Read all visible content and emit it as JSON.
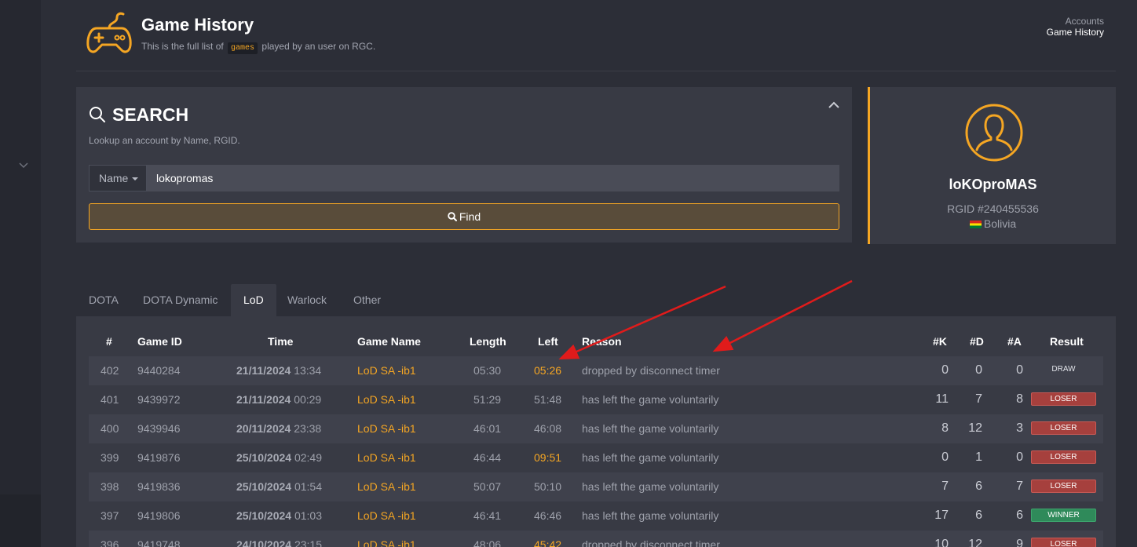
{
  "header": {
    "title": "Game History",
    "subtitle_before": "This is the full list of",
    "subtitle_code": "games",
    "subtitle_after": "played by an user on RGC.",
    "breadcrumb": [
      "Accounts",
      "Game History"
    ]
  },
  "search": {
    "title": "SEARCH",
    "help": "Lookup an account by Name, RGID.",
    "field_type": "Name",
    "value": "lokopromas",
    "button_label": "Find"
  },
  "profile": {
    "name": "loKOproMAS",
    "rgid": "RGID #240455536",
    "country": "Bolivia"
  },
  "tabs": [
    "DOTA",
    "DOTA Dynamic",
    "LoD",
    "Warlock",
    "Other"
  ],
  "active_tab": "LoD",
  "table": {
    "headers": {
      "num": "#",
      "game_id": "Game ID",
      "time": "Time",
      "game_name": "Game Name",
      "length": "Length",
      "left": "Left",
      "reason": "Reason",
      "k": "#K",
      "d": "#D",
      "a": "#A",
      "result": "Result"
    },
    "rows": [
      {
        "num": "402",
        "game_id": "9440284",
        "date": "21/11/2024",
        "clock": "13:34",
        "game_name": "LoD SA -ib1",
        "length": "05:30",
        "left": "05:26",
        "left_highlight": true,
        "reason": "dropped by disconnect timer",
        "k": "0",
        "d": "0",
        "a": "0",
        "result": "DRAW"
      },
      {
        "num": "401",
        "game_id": "9439972",
        "date": "21/11/2024",
        "clock": "00:29",
        "game_name": "LoD SA -ib1",
        "length": "51:29",
        "left": "51:48",
        "left_highlight": false,
        "reason": "has left the game voluntarily",
        "k": "11",
        "d": "7",
        "a": "8",
        "result": "LOSER"
      },
      {
        "num": "400",
        "game_id": "9439946",
        "date": "20/11/2024",
        "clock": "23:38",
        "game_name": "LoD SA -ib1",
        "length": "46:01",
        "left": "46:08",
        "left_highlight": false,
        "reason": "has left the game voluntarily",
        "k": "8",
        "d": "12",
        "a": "3",
        "result": "LOSER"
      },
      {
        "num": "399",
        "game_id": "9419876",
        "date": "25/10/2024",
        "clock": "02:49",
        "game_name": "LoD SA -ib1",
        "length": "46:44",
        "left": "09:51",
        "left_highlight": true,
        "reason": "has left the game voluntarily",
        "k": "0",
        "d": "1",
        "a": "0",
        "result": "LOSER"
      },
      {
        "num": "398",
        "game_id": "9419836",
        "date": "25/10/2024",
        "clock": "01:54",
        "game_name": "LoD SA -ib1",
        "length": "50:07",
        "left": "50:10",
        "left_highlight": false,
        "reason": "has left the game voluntarily",
        "k": "7",
        "d": "6",
        "a": "7",
        "result": "LOSER"
      },
      {
        "num": "397",
        "game_id": "9419806",
        "date": "25/10/2024",
        "clock": "01:03",
        "game_name": "LoD SA -ib1",
        "length": "46:41",
        "left": "46:46",
        "left_highlight": false,
        "reason": "has left the game voluntarily",
        "k": "17",
        "d": "6",
        "a": "6",
        "result": "WINNER"
      },
      {
        "num": "396",
        "game_id": "9419748",
        "date": "24/10/2024",
        "clock": "23:15",
        "game_name": "LoD SA -ib1",
        "length": "48:06",
        "left": "45:42",
        "left_highlight": true,
        "reason": "dropped by disconnect timer",
        "k": "10",
        "d": "12",
        "a": "9",
        "result": "LOSER"
      }
    ]
  },
  "colors": {
    "accent": "#f5a623",
    "background": "#2c2e37",
    "panel": "#383a44",
    "loser": "#a6403d",
    "winner": "#2f8a5a",
    "annotation_arrow": "#e01b1b"
  },
  "icons": [
    "gamepad-icon",
    "search-icon",
    "chevron-up-icon",
    "user-avatar-icon",
    "flag-bolivia-icon"
  ]
}
